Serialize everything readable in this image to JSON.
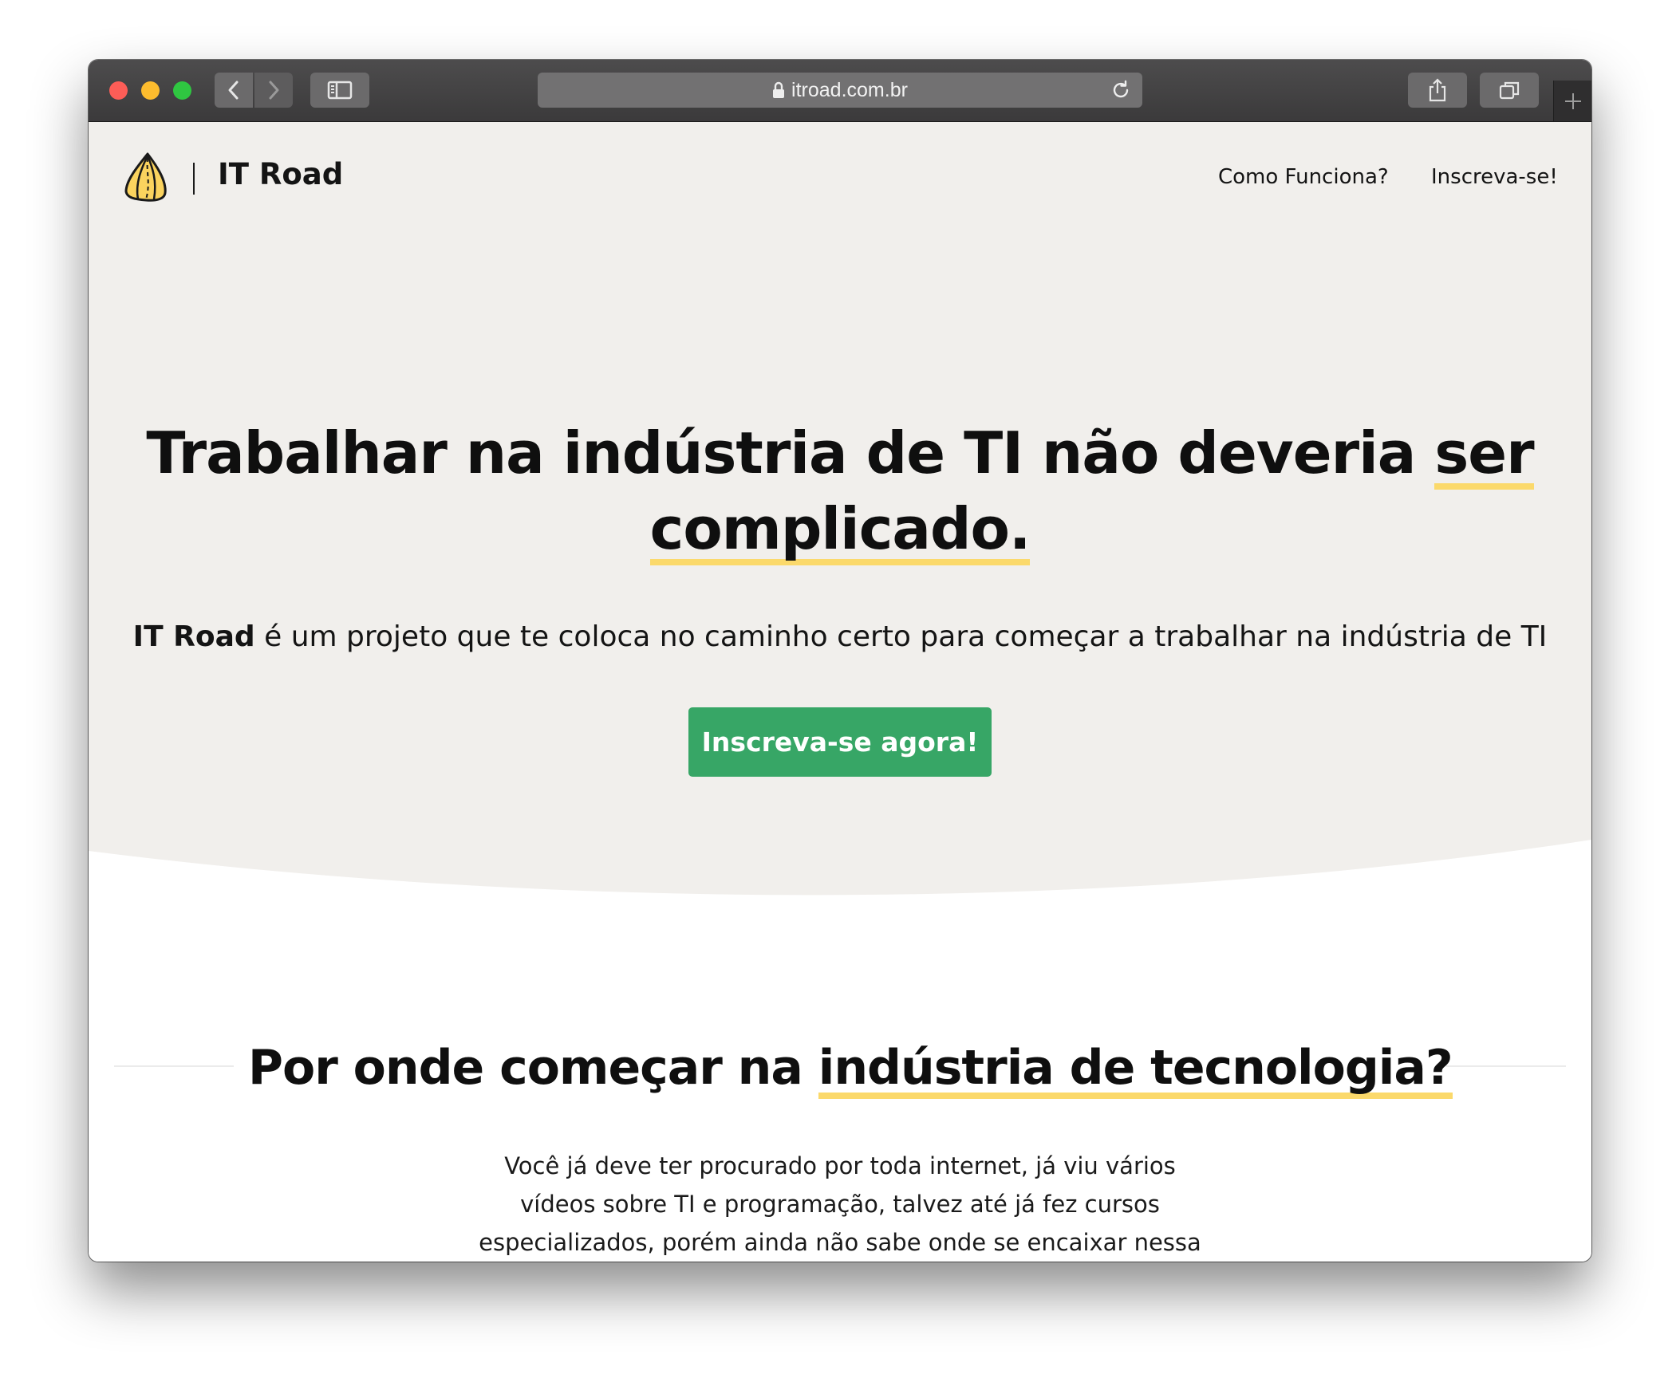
{
  "browser": {
    "url": "itroad.com.br"
  },
  "site": {
    "logo_text": "IT Road",
    "nav": [
      {
        "label": "Como Funciona?"
      },
      {
        "label": "Inscreva-se!"
      }
    ]
  },
  "hero": {
    "title_part1": "Trabalhar na indústria de TI não deveria ",
    "title_highlight1": "ser",
    "title_highlight2": "complicado.",
    "subtitle_bold": "IT Road",
    "subtitle_rest": " é um projeto que te coloca no caminho certo para começar a trabalhar na indústria de TI",
    "cta_label": "Inscreva-se agora!"
  },
  "section": {
    "title_part1": "Por onde começar na ",
    "title_highlight": "indústria de tecnologia?",
    "text": "Você já deve ter procurado por toda internet, já viu vários vídeos sobre TI e programação, talvez até já fez cursos especializados, porém ainda não sabe onde se encaixar nessa indústria gigante?"
  },
  "colors": {
    "hero_background": "#f1efec",
    "accent_highlight": "#fbd96b",
    "cta_background": "#37a666"
  },
  "icons": {
    "logo": "road-logo-icon",
    "back": "chevron-left-icon",
    "forward": "chevron-right-icon",
    "sidebar": "sidebar-icon",
    "lock": "lock-icon",
    "reload": "reload-icon",
    "share": "share-icon",
    "tabs": "tabs-icon",
    "new_tab": "plus-icon"
  }
}
